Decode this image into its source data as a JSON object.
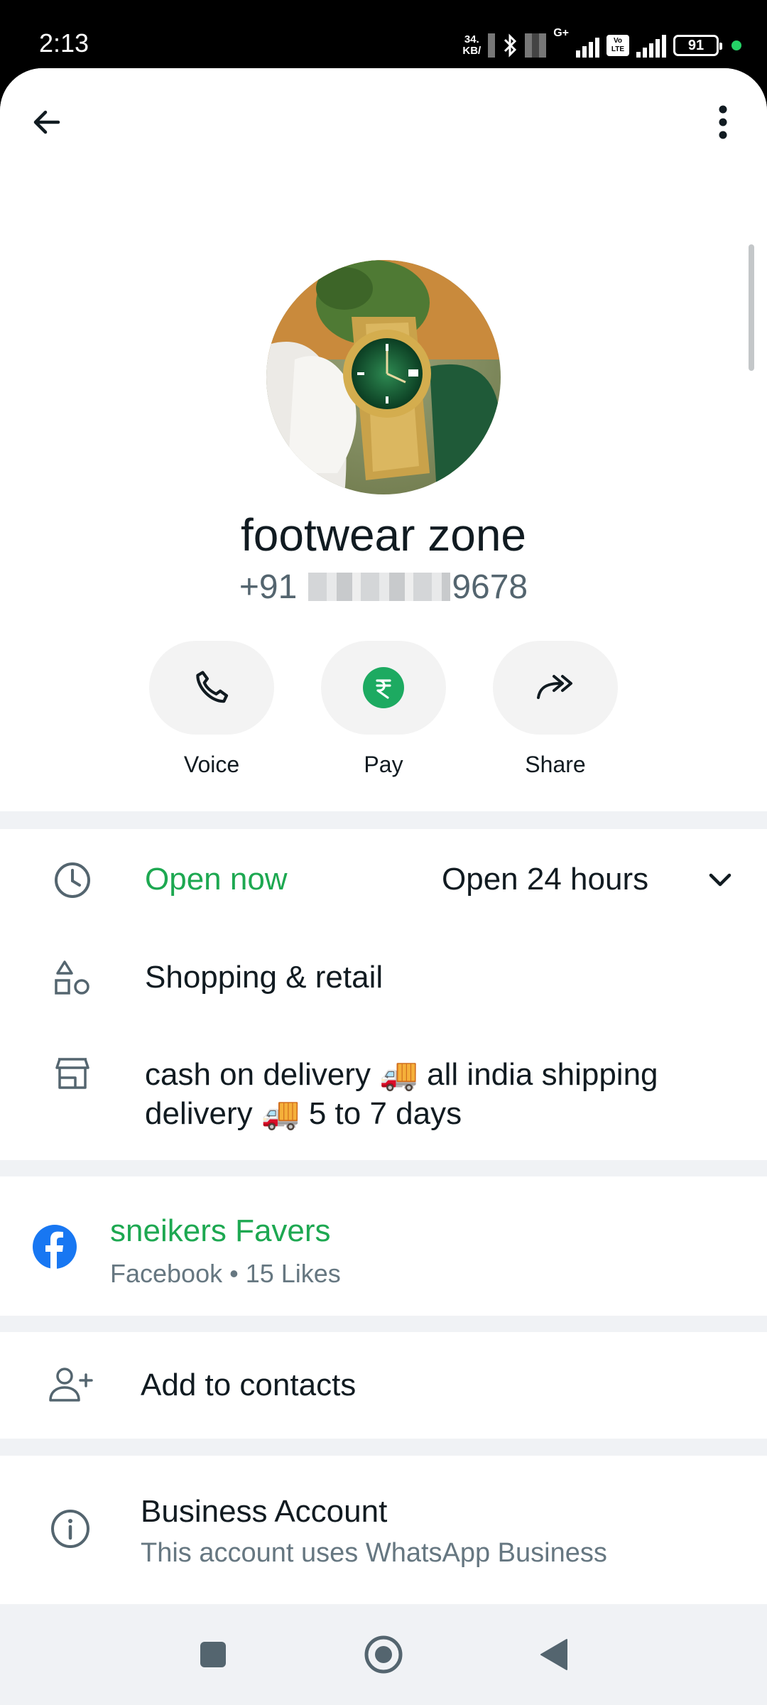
{
  "status_bar": {
    "time": "2:13",
    "net_speed_top": "34.",
    "net_speed_bottom": "KB/",
    "network_gen": "G+",
    "volte": "Vo LTE",
    "battery": "91"
  },
  "top_bar": {
    "back_icon": "arrow-left-icon",
    "menu_icon": "more-vert-icon"
  },
  "profile": {
    "name": "footwear zone",
    "phone_prefix": "+91",
    "phone_suffix": "9678"
  },
  "actions": [
    {
      "label": "Voice",
      "icon": "phone-icon"
    },
    {
      "label": "Pay",
      "icon": "rupee-icon"
    },
    {
      "label": "Share",
      "icon": "share-forward-icon"
    }
  ],
  "business_info": {
    "hours_status": "Open now",
    "hours_detail": "Open 24 hours",
    "category": "Shopping & retail",
    "description_line1": "cash on delivery 🚚 all india shipping",
    "description_line2": "delivery 🚚 5 to 7 days"
  },
  "facebook": {
    "page_name": "sneikers Favers",
    "meta": "Facebook • 15 Likes"
  },
  "add_contact": {
    "label": "Add to contacts"
  },
  "business_account": {
    "title": "Business Account",
    "subtitle": "This account uses WhatsApp Business"
  },
  "colors": {
    "accent_green": "#1da851",
    "pay_green": "#1daa61",
    "facebook_blue": "#1877f2"
  }
}
